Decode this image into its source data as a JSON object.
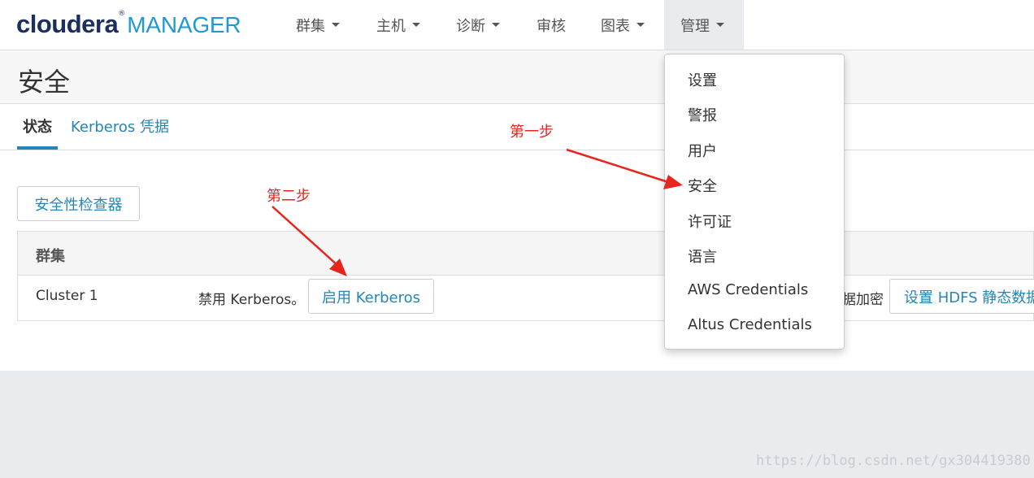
{
  "navbar": {
    "logo": {
      "brand": "cloudera",
      "reg": "®",
      "product": "MANAGER"
    },
    "items": [
      {
        "label": "群集",
        "has_caret": true
      },
      {
        "label": "主机",
        "has_caret": true
      },
      {
        "label": "诊断",
        "has_caret": true
      },
      {
        "label": "审核",
        "has_caret": false
      },
      {
        "label": "图表",
        "has_caret": true
      },
      {
        "label": "管理",
        "has_caret": true,
        "active": true
      }
    ]
  },
  "page": {
    "title": "安全"
  },
  "tabs": [
    {
      "label": "状态",
      "active": true
    },
    {
      "label": "Kerberos 凭据",
      "active": false
    }
  ],
  "security_inspector_button": "安全性检查器",
  "table": {
    "header": "群集",
    "rows": [
      {
        "cluster": "Cluster 1",
        "kerberos_status": "禁用 Kerberos。",
        "enable_kerberos_button": "启用 Kerberos",
        "encryption_text": "据加密",
        "hdfs_encryption_button": "设置 HDFS 静态数据"
      }
    ]
  },
  "admin_menu": {
    "items": [
      "设置",
      "警报",
      "用户",
      "安全",
      "许可证",
      "语言",
      "AWS Credentials",
      "Altus Credentials"
    ]
  },
  "annotations": {
    "step1": "第一步",
    "step2": "第二步",
    "color": "#e8251c"
  },
  "watermark": "https://blog.csdn.net/gx304419380",
  "colors": {
    "accent": "#2586b6",
    "logo_dark": "#1b2f5e",
    "logo_light": "#1d9ad6",
    "page_bg": "#e9ecef"
  }
}
